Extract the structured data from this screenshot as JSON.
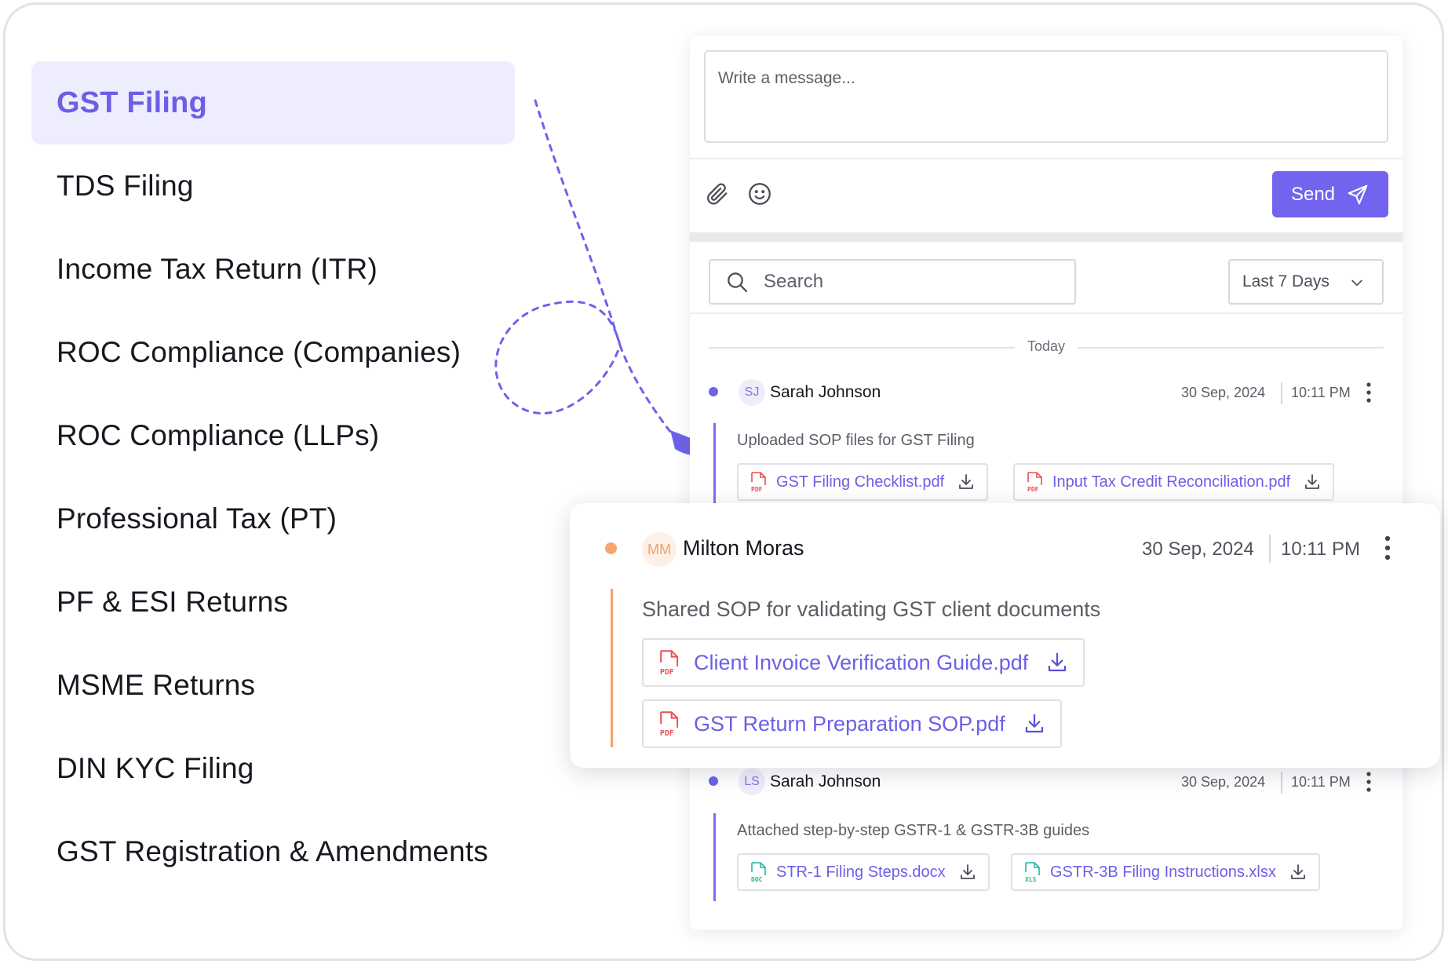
{
  "nav": {
    "items": [
      {
        "label": "GST Filing",
        "active": true
      },
      {
        "label": "TDS Filing"
      },
      {
        "label": "Income Tax Return (ITR)"
      },
      {
        "label": "ROC Compliance (Companies)"
      },
      {
        "label": "ROC Compliance (LLPs)"
      },
      {
        "label": "Professional Tax (PT)"
      },
      {
        "label": "PF & ESI Returns"
      },
      {
        "label": "MSME Returns"
      },
      {
        "label": "DIN KYC Filing"
      },
      {
        "label": "GST Registration & Amendments"
      }
    ]
  },
  "composer": {
    "placeholder": "Write a message...",
    "attach_icon": "paperclip-icon",
    "emoji_icon": "smiley-icon",
    "send_label": "Send",
    "send_icon": "paper-plane-icon"
  },
  "filters": {
    "search_placeholder": "Search",
    "range_label": "Last 7 Days"
  },
  "day_separator": "Today",
  "messages": [
    {
      "initials": "SJ",
      "sender": "Sarah Johnson",
      "date": "30 Sep, 2024",
      "time": "10:11 PM",
      "caption": "Uploaded SOP files for GST Filing",
      "files": [
        {
          "type": "PDF",
          "name": "GST Filing Checklist.pdf"
        },
        {
          "type": "PDF",
          "name": "Input Tax Credit Reconciliation.pdf"
        }
      ]
    },
    {
      "initials": "MM",
      "sender": "Milton Moras",
      "date": "30 Sep, 2024",
      "time": "10:11 PM",
      "caption": "Shared SOP for validating GST client documents",
      "files": [
        {
          "type": "PDF",
          "name": "Client Invoice Verification Guide.pdf"
        },
        {
          "type": "PDF",
          "name": "GST Return Preparation SOP.pdf"
        }
      ]
    },
    {
      "initials": "LS",
      "sender": "Sarah Johnson",
      "date": "30 Sep, 2024",
      "time": "10:11 PM",
      "caption": "Attached step-by-step GSTR-1 & GSTR-3B guides",
      "files": [
        {
          "type": "DOC",
          "name": "STR-1 Filing Steps.docx"
        },
        {
          "type": "XLS",
          "name": "GSTR-3B Filing Instructions.xlsx"
        }
      ]
    }
  ],
  "colors": {
    "accent": "#7264ef",
    "active_bg": "#eeedfd",
    "status_blue": "#6d63e9",
    "status_orange": "#f7a56a",
    "pdf_red": "#ef4f4f",
    "doc_teal": "#1fb7a8"
  }
}
